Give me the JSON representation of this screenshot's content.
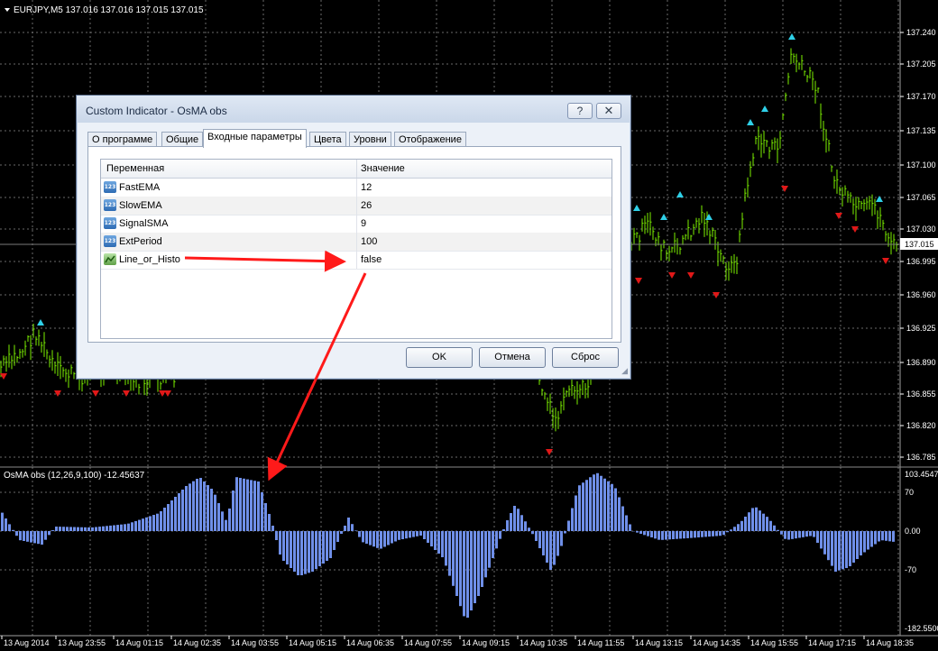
{
  "chart_header": "EURJPY,M5  137.016 137.016 137.015 137.015",
  "indicator_label": "OsMA obs (12,26,9,100) -12.45637",
  "price_axis": [
    "137.240",
    "137.205",
    "137.170",
    "137.135",
    "137.100",
    "137.065",
    "137.030",
    "137.015",
    "136.995",
    "136.960",
    "136.925",
    "136.890",
    "136.855",
    "136.820",
    "136.785"
  ],
  "current_price": "137.015",
  "osma_axis": [
    "103.4547",
    "70",
    "0.00",
    "-70",
    "-182.5500"
  ],
  "time_axis": [
    "13 Aug 2014",
    "13 Aug 23:55",
    "14 Aug 01:15",
    "14 Aug 02:35",
    "14 Aug 03:55",
    "14 Aug 05:15",
    "14 Aug 06:35",
    "14 Aug 07:55",
    "14 Aug 09:15",
    "14 Aug 10:35",
    "14 Aug 11:55",
    "14 Aug 13:15",
    "14 Aug 14:35",
    "14 Aug 15:55",
    "14 Aug 17:15",
    "14 Aug 18:35"
  ],
  "colors": {
    "bars": "#7cf000",
    "histogram": "#6f8fe8",
    "up_arrow": "#2fd0e8",
    "down_arrow": "#e01818",
    "annotation_arrow": "#ff1a1a"
  },
  "dialog": {
    "title": "Custom Indicator - OsMA obs",
    "help_glyph": "?",
    "close_glyph": "✕",
    "tabs": [
      "О программе",
      "Общие",
      "Входные параметры",
      "Цвета",
      "Уровни",
      "Отображение"
    ],
    "active_tab": "Входные параметры",
    "columns": {
      "variable": "Переменная",
      "value": "Значение"
    },
    "params": [
      {
        "name": "FastEMA",
        "value": "12",
        "icon": "integer-icon"
      },
      {
        "name": "SlowEMA",
        "value": "26",
        "icon": "integer-icon"
      },
      {
        "name": "SignalSMA",
        "value": "9",
        "icon": "integer-icon"
      },
      {
        "name": "ExtPeriod",
        "value": "100",
        "icon": "integer-icon"
      },
      {
        "name": "Line_or_Histo",
        "value": "false",
        "icon": "boolean-icon"
      }
    ],
    "type_icon_text": "123",
    "buttons": {
      "ok": "OK",
      "cancel": "Отмена",
      "reset": "Сброс"
    }
  }
}
